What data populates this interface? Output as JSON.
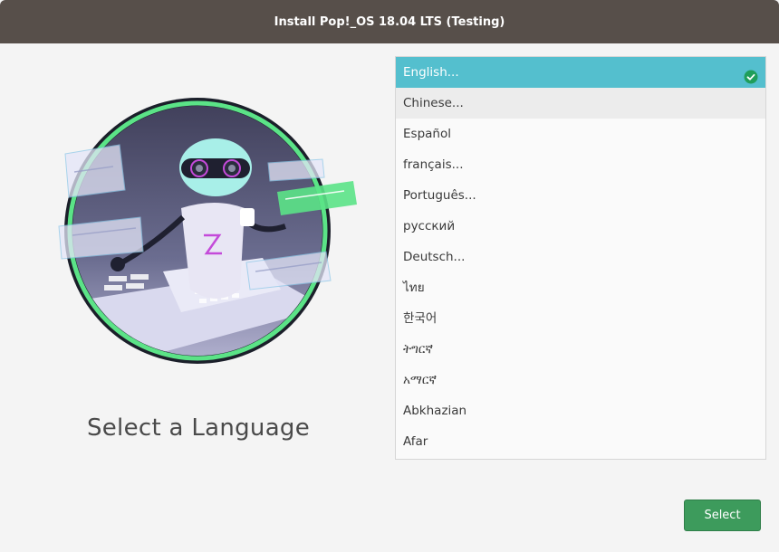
{
  "window": {
    "title": "Install Pop!_OS 18.04 LTS (Testing)"
  },
  "main": {
    "heading": "Select a Language"
  },
  "languages": {
    "items": [
      {
        "label": "English...",
        "state": "selected"
      },
      {
        "label": "Chinese...",
        "state": "hover"
      },
      {
        "label": "Español",
        "state": "normal"
      },
      {
        "label": "français...",
        "state": "normal"
      },
      {
        "label": "Português...",
        "state": "normal"
      },
      {
        "label": "русский",
        "state": "normal"
      },
      {
        "label": "Deutsch...",
        "state": "normal"
      },
      {
        "label": "ไทย",
        "state": "normal"
      },
      {
        "label": "한국어",
        "state": "normal"
      },
      {
        "label": "ትግርኛ",
        "state": "normal"
      },
      {
        "label": "አማርኛ",
        "state": "normal"
      },
      {
        "label": "Abkhazian",
        "state": "normal"
      },
      {
        "label": "Afar",
        "state": "normal"
      }
    ]
  },
  "footer": {
    "select_label": "Select"
  },
  "colors": {
    "titlebar": "#574f4a",
    "selected_row": "#54bfce",
    "select_button": "#3d9b5c",
    "illustration_ring": "#5be387"
  },
  "icons": {
    "selected_marker": "check-circle-icon"
  }
}
